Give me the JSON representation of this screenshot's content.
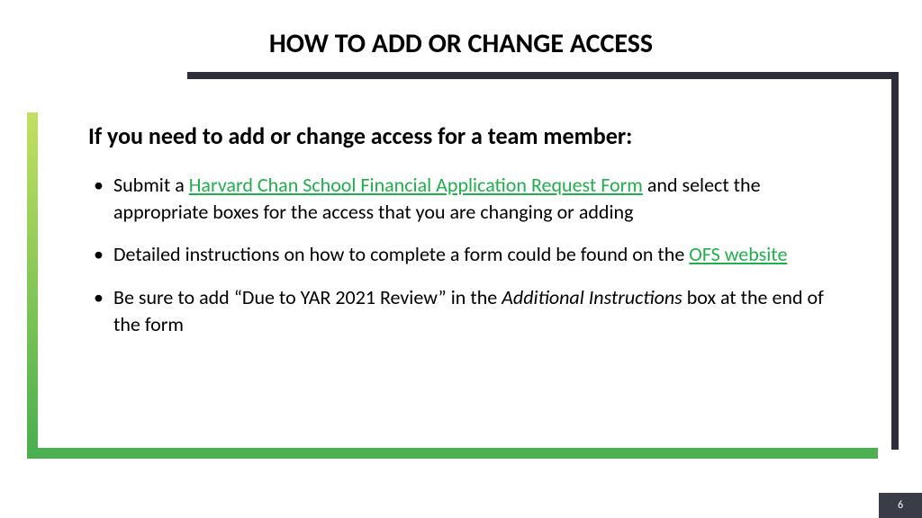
{
  "title": "HOW TO ADD OR CHANGE ACCESS",
  "subtitle": "If you need to add or change access for a team member:",
  "bullets": {
    "b1_pre": "Submit a ",
    "b1_link": "Harvard Chan School Financial Application Request Form",
    "b1_post": " and select the appropriate boxes for the access that you are changing or adding",
    "b2_pre": "Detailed instructions on how to complete a form could be found on the ",
    "b2_link": "OFS website",
    "b3_pre": "Be sure to add “Due to YAR 2021 Review” in the ",
    "b3_italic": "Additional Instructions",
    "b3_post": " box at the end of the form"
  },
  "page_number": "6"
}
